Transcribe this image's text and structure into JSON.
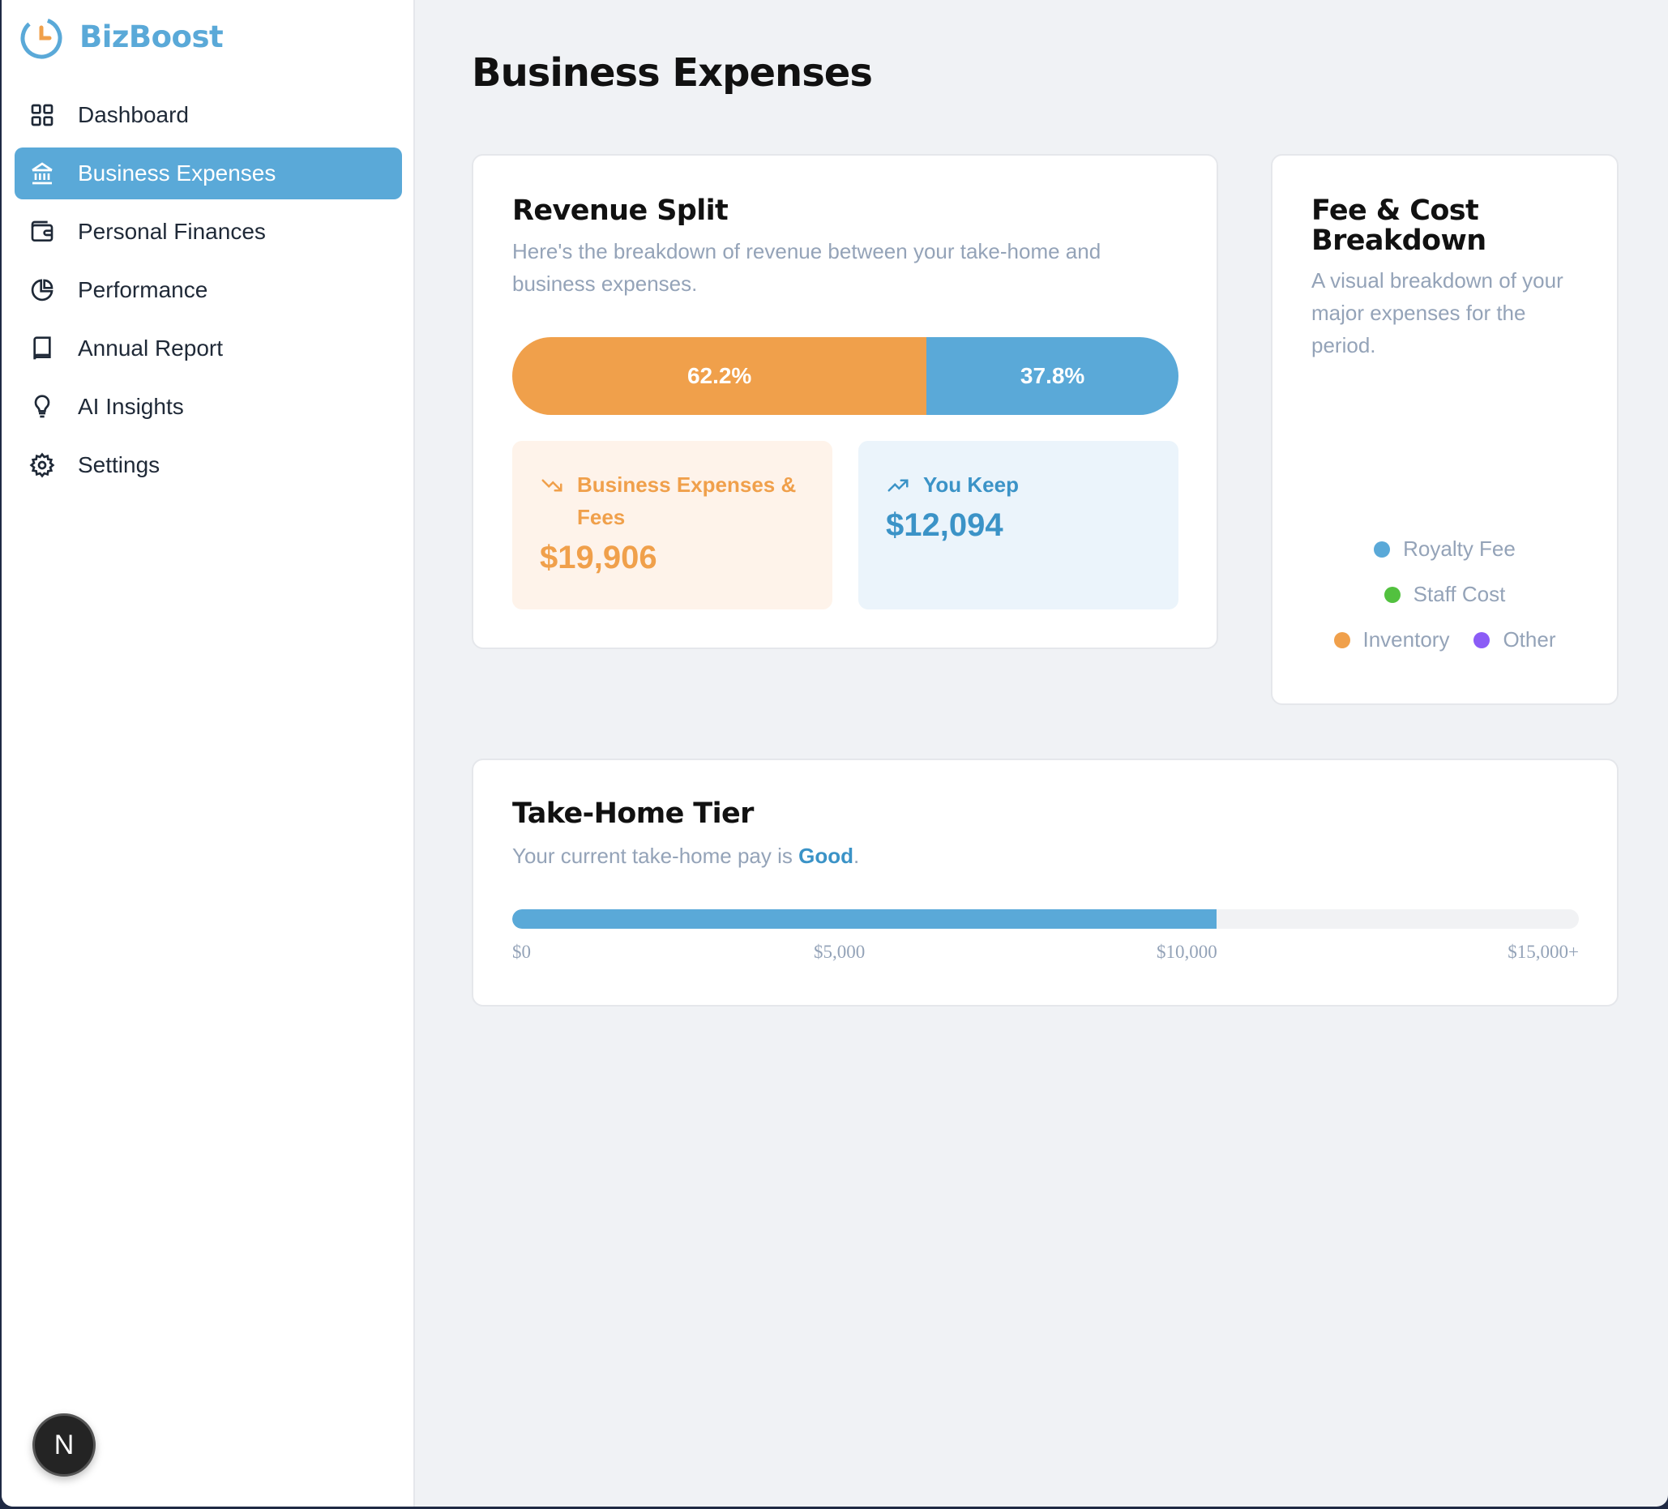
{
  "app": {
    "name": "BizBoost"
  },
  "sidebar": {
    "items": [
      {
        "label": "Dashboard",
        "icon": "grid-icon",
        "active": false
      },
      {
        "label": "Business Expenses",
        "icon": "bank-icon",
        "active": true
      },
      {
        "label": "Personal Finances",
        "icon": "wallet-icon",
        "active": false
      },
      {
        "label": "Performance",
        "icon": "pie-chart-icon",
        "active": false
      },
      {
        "label": "Annual Report",
        "icon": "book-icon",
        "active": false
      },
      {
        "label": "AI Insights",
        "icon": "lightbulb-icon",
        "active": false
      },
      {
        "label": "Settings",
        "icon": "gear-icon",
        "active": false
      }
    ],
    "badge": "N"
  },
  "page": {
    "title": "Business Expenses"
  },
  "revenue_split": {
    "title": "Revenue Split",
    "subtitle": "Here's the breakdown of revenue between your take-home and business expenses.",
    "expenses_pct_label": "62.2%",
    "keep_pct_label": "37.8%",
    "expenses_fraction": 0.622,
    "keep_fraction": 0.378,
    "expenses": {
      "label": "Business Expenses & Fees",
      "value": "$19,906",
      "icon": "trending-down-icon"
    },
    "keep": {
      "label": "You Keep",
      "value": "$12,094",
      "icon": "trending-up-icon"
    }
  },
  "fee_breakdown": {
    "title": "Fee & Cost Breakdown",
    "subtitle": "A visual breakdown of your major expenses for the period.",
    "legend": [
      {
        "label": "Royalty Fee",
        "color": "#5aa9d8"
      },
      {
        "label": "Staff Cost",
        "color": "#52c13f"
      },
      {
        "label": "Inventory",
        "color": "#f0a04b"
      },
      {
        "label": "Other",
        "color": "#8b5cf6"
      }
    ]
  },
  "take_home_tier": {
    "title": "Take-Home Tier",
    "subtitle_prefix": "Your current take-home pay is",
    "tier": "Good",
    "subtitle_suffix": ".",
    "progress_fraction": 0.66,
    "scale_labels": [
      "$0",
      "$5,000",
      "$10,000",
      "$15,000+"
    ]
  },
  "colors": {
    "accent_blue": "#5aa9d8",
    "accent_orange": "#f0a04b",
    "expense_bg": "#fef3ea",
    "keep_bg": "#ebf4fb"
  }
}
